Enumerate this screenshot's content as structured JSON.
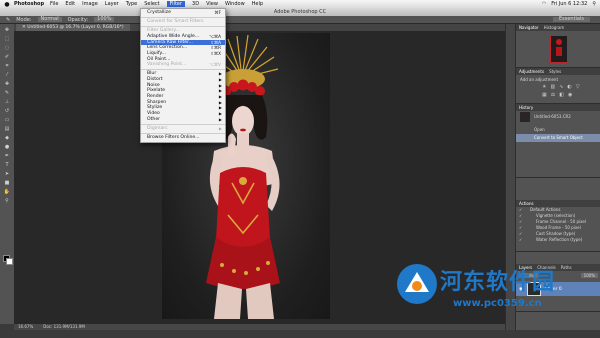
{
  "os_menubar": {
    "app_name": "Photoshop",
    "items": [
      "File",
      "Edit",
      "Image",
      "Layer",
      "Type",
      "Select",
      "Filter",
      "3D",
      "View",
      "Window",
      "Help"
    ],
    "active_item": "Filter",
    "clock": "Fri Jun 6 12:32"
  },
  "window": {
    "title": "Adobe Photoshop CC"
  },
  "options_bar": {
    "mode_label": "Mode:",
    "mode_value": "Normal",
    "opacity_label": "Opacity:",
    "opacity_value": "100%",
    "workspace": "Essentials"
  },
  "document": {
    "tab_title": "Untitled-6053 @ 16.7% (Layer 0, RGB/16*)"
  },
  "status_bar": {
    "zoom": "16.67%",
    "doc_size": "Doc: 131.9M/131.9M"
  },
  "filter_menu": {
    "items": [
      {
        "label": "Crystallize",
        "shortcut": "⌘F",
        "state": "normal"
      },
      {
        "sep": true
      },
      {
        "label": "Convert for Smart Filters",
        "state": "disabled"
      },
      {
        "sep": true
      },
      {
        "label": "Filter Gallery...",
        "state": "disabled"
      },
      {
        "label": "Adaptive Wide Angle...",
        "shortcut": "⌥⌘A",
        "state": "normal"
      },
      {
        "label": "Camera Raw Filter...",
        "shortcut": "⇧⌘A",
        "state": "highlighted"
      },
      {
        "label": "Lens Correction...",
        "shortcut": "⇧⌘R",
        "state": "normal"
      },
      {
        "label": "Liquify...",
        "shortcut": "⇧⌘X",
        "state": "normal"
      },
      {
        "label": "Oil Paint...",
        "state": "normal"
      },
      {
        "label": "Vanishing Point...",
        "shortcut": "⌥⌘V",
        "state": "disabled"
      },
      {
        "sep": true
      },
      {
        "label": "Blur",
        "submenu": true,
        "state": "normal"
      },
      {
        "label": "Distort",
        "submenu": true,
        "state": "normal"
      },
      {
        "label": "Noise",
        "submenu": true,
        "state": "normal"
      },
      {
        "label": "Pixelate",
        "submenu": true,
        "state": "normal"
      },
      {
        "label": "Render",
        "submenu": true,
        "state": "normal"
      },
      {
        "label": "Sharpen",
        "submenu": true,
        "state": "normal"
      },
      {
        "label": "Stylize",
        "submenu": true,
        "state": "normal"
      },
      {
        "label": "Video",
        "submenu": true,
        "state": "normal"
      },
      {
        "label": "Other",
        "submenu": true,
        "state": "normal"
      },
      {
        "sep": true
      },
      {
        "label": "Digimarc",
        "submenu": true,
        "state": "disabled"
      },
      {
        "sep": true
      },
      {
        "label": "Browse Filters Online...",
        "state": "normal"
      }
    ]
  },
  "panels": {
    "navigator_tabs": [
      "Navigator",
      "Histogram"
    ],
    "adjustments_tabs": [
      "Adjustments",
      "Styles"
    ],
    "adjustments_hint": "Add an adjustment",
    "history": {
      "tab": "History",
      "snapshot": "Untitled-6053.CR2",
      "rows": [
        "Open",
        "Convert to Smart Object"
      ],
      "selected_index": 1
    },
    "actions": {
      "tab": "Actions",
      "rows": [
        "Default Actions",
        "Vignette (selection)",
        "Frame Channel - 50 pixel",
        "Wood Frame - 50 pixel",
        "Cast Shadow (type)",
        "Water Reflection (type)"
      ]
    },
    "layers": {
      "tabs": [
        "Layers",
        "Channels",
        "Paths"
      ],
      "blend_mode": "Normal",
      "opacity": "100%",
      "layer_name": "Layer 0"
    }
  },
  "watermark": {
    "text": "河东软件园",
    "url": "www.pc0359.cn"
  }
}
